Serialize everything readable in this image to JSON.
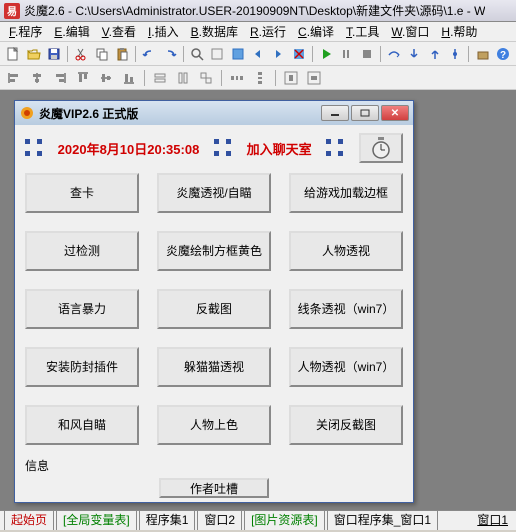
{
  "main_title": "炎魔2.6 - C:\\Users\\Administrator.USER-20190909NT\\Desktop\\新建文件夹\\源码\\1.e - W",
  "menus": [
    {
      "u": "F",
      "label": ".程序"
    },
    {
      "u": "E",
      "label": ".编辑"
    },
    {
      "u": "V",
      "label": ".查看"
    },
    {
      "u": "I",
      "label": ".插入"
    },
    {
      "u": "B",
      "label": ".数据库"
    },
    {
      "u": "R",
      "label": ".运行"
    },
    {
      "u": "C",
      "label": ".编译"
    },
    {
      "u": "T",
      "label": ".工具"
    },
    {
      "u": "W",
      "label": ".窗口"
    },
    {
      "u": "H",
      "label": ".帮助"
    }
  ],
  "inner": {
    "title": "炎魔VIP2.6 正式版",
    "timestamp": "2020年8月10日20:35:08",
    "chatroom": "加入聊天室",
    "buttons": [
      "查卡",
      "炎魔透视/自瞄",
      "给游戏加载边框",
      "过检测",
      "炎魔绘制方框黄色",
      "人物透视",
      "语言暴力",
      "反截图",
      "线条透视（win7）",
      "安装防封插件",
      "躲猫猫透视",
      "人物透视（win7）",
      "和风自瞄",
      "人物上色",
      "关闭反截图"
    ],
    "info_label": "信息",
    "author_btn": "作者吐槽"
  },
  "tabs": [
    {
      "label": "起始页",
      "cls": "red"
    },
    {
      "label": "[全局变量表]",
      "cls": "green"
    },
    {
      "label": "程序集1",
      "cls": ""
    },
    {
      "label": "窗口2",
      "cls": ""
    },
    {
      "label": "[图片资源表]",
      "cls": "green"
    },
    {
      "label": "窗口程序集_窗口1",
      "cls": ""
    }
  ],
  "tab_right": "窗口1"
}
